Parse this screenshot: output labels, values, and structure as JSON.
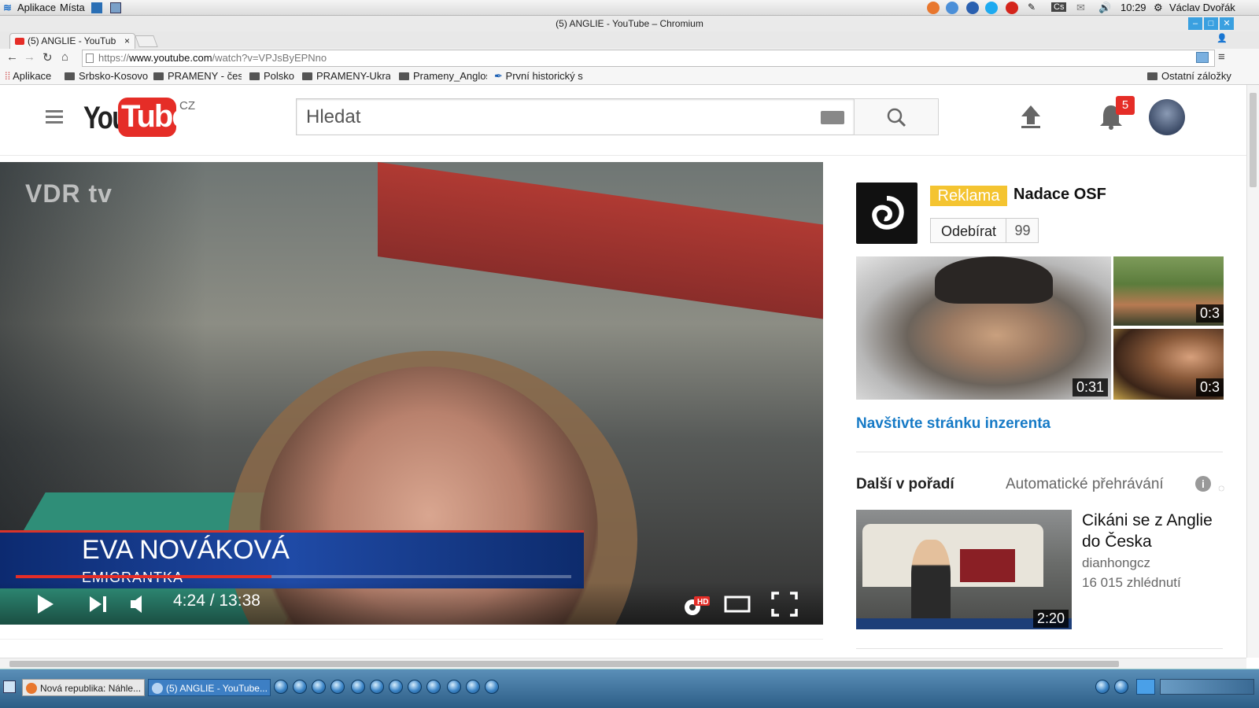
{
  "os": {
    "apps_label": "Aplikace",
    "places_label": "Místa",
    "clock": "10:29",
    "user": "Václav Dvořák",
    "lang": "Cs"
  },
  "window": {
    "title": "(5) ANGLIE - YouTube – Chromium"
  },
  "tab": {
    "title": "(5) ANGLIE - YouTub",
    "close": "×"
  },
  "omnibox": {
    "scheme": "https://",
    "host": "www.youtube.com",
    "path": "/watch?v=VPJsByEPNno"
  },
  "bookmarks": {
    "apps": "Aplikace",
    "items": [
      "Srbsko-Kosovo",
      "PRAMENY - česk",
      "Polsko",
      "PRAMENY-Ukraji",
      "Prameny_Anglos",
      "První historický s"
    ],
    "other": "Ostatní záložky"
  },
  "yt": {
    "logo_you": "You",
    "logo_tube": "Tube",
    "region": "CZ",
    "search_placeholder": "Hledat",
    "notification_count": "5"
  },
  "player": {
    "watermark": "VDR tv",
    "lower_third_name": "EVA NOVÁKOVÁ",
    "lower_third_role": "EMIGRANTKA",
    "current_time": "4:24",
    "duration": "13:38",
    "time_display": "4:24 / 13:38",
    "progress_fraction": 0.46,
    "hd_badge": "HD"
  },
  "ad": {
    "tag": "Reklama",
    "name": "Nadace OSF",
    "subscribe_label": "Odebírat",
    "subscriber_count": "99",
    "thumb_main_duration": "0:31",
    "thumb_small1_duration": "0:3",
    "thumb_small2_duration": "0:3",
    "link": "Navštivte stránku inzerenta"
  },
  "up_next": {
    "header": "Další v pořadí",
    "autoplay_label": "Automatické přehrávání",
    "info": "i",
    "video": {
      "title": "Cikáni se z Anglie do Česka",
      "channel": "dianhongcz",
      "views": "16 015 zhlédnutí",
      "duration": "2:20"
    }
  },
  "taskbar": {
    "tasks": [
      "Nová republika: Náhle...",
      "(5) ANGLIE - YouTube..."
    ]
  },
  "colors": {
    "yt_red": "#e52d27",
    "link_blue": "#167ac6",
    "ad_yellow": "#f4c431",
    "lower_third_blue": "#1f4aa6"
  }
}
